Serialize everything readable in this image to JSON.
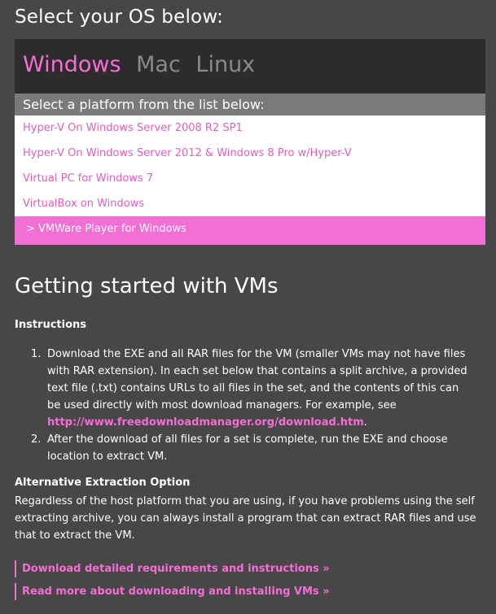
{
  "header": {
    "title": "Select your OS below:"
  },
  "os_tabs": [
    {
      "label": "Windows",
      "active": true
    },
    {
      "label": "Mac",
      "active": false
    },
    {
      "label": "Linux",
      "active": false
    }
  ],
  "platforms": {
    "header": "Select a platform from the list below:",
    "items": [
      {
        "label": "Hyper-V On Windows Server 2008 R2 SP1"
      },
      {
        "label": "Hyper-V On Windows Server 2012 & Windows 8 Pro w/Hyper-V"
      },
      {
        "label": "Virtual PC for Windows 7"
      },
      {
        "label": "VirtualBox on Windows"
      },
      {
        "label": "> VMWare Player for Windows",
        "selected": true
      }
    ]
  },
  "content": {
    "title": "Getting started with VMs",
    "instructions_title": "Instructions",
    "steps": [
      {
        "num": "1.",
        "text": "Download the EXE and all RAR files for the VM (smaller VMs may not have files with RAR extension). In each set below that contains a split archive, a provided text file (.txt) contains URLs to all files in the set, and the contents of this can be used directly with most download managers. For example, see ",
        "link": "http://www.freedownloadmanager.org/download.htm",
        "after": "."
      },
      {
        "num": "2.",
        "text": "After the download of all files for a set is complete, run the EXE and choose location to extract VM."
      }
    ],
    "alt_title": "Alternative Extraction Option",
    "alt_text": "Regardless of the host platform that you are using, if you have problems using the self extracting archive, you can always install a program that can extract RAR files and use that to extract the VM."
  },
  "links": [
    {
      "label": "Download detailed requirements and instructions »"
    },
    {
      "label": "Read more about downloading and installing VMs »"
    }
  ],
  "colors": {
    "background": "#474747",
    "accent": "#f26fd4",
    "panel": "#2d2b2c",
    "platform_header": "#7a7a7a"
  }
}
